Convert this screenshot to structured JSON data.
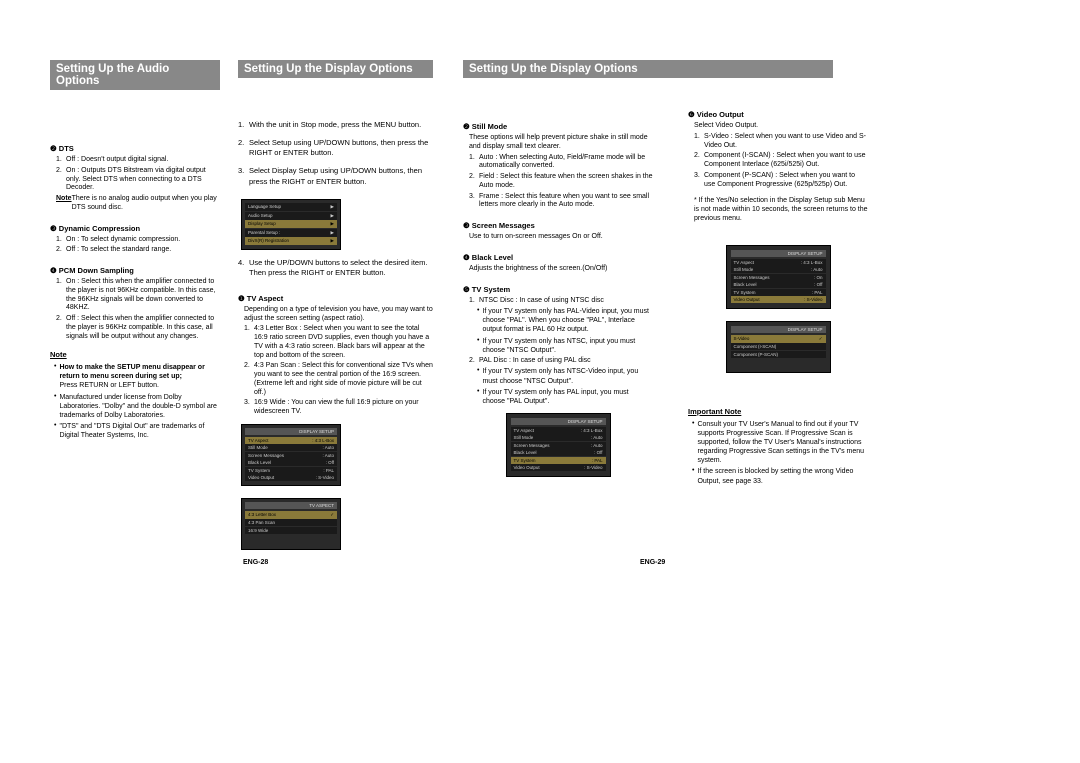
{
  "headers": {
    "h1": "Setting Up the Audio Options",
    "h2": "Setting Up the Display Options",
    "h3": "Setting Up the Display Options"
  },
  "col1": {
    "s1_hd": "❷ DTS",
    "s1_i1n": "1.",
    "s1_i1t": "Off : Doesn't output digital signal.",
    "s1_i2n": "2.",
    "s1_i2t": "On : Outputs DTS Bitstream via digital output only. Select DTS when connecting to a DTS Decoder.",
    "s1_note_pre": "Note",
    "s1_note": "There is no analog audio output when you play DTS sound disc.",
    "s2_hd": "❸ Dynamic Compression",
    "s2_i1n": "1.",
    "s2_i1t": "On : To select dynamic compression.",
    "s2_i2n": "2.",
    "s2_i2t": "Off : To select the standard range.",
    "s3_hd": "❹ PCM Down Sampling",
    "s3_i1n": "1.",
    "s3_i1t": "On : Select this when the amplifier connected to the player is not 96KHz compatible. In this case, the 96KHz signals will be down converted to 48KHZ.",
    "s3_i2n": "2.",
    "s3_i2t": "Off : Select this when the amplifier connected to the player is 96KHz compatible. In this case, all signals will be output without any changes.",
    "note_hd": "Note",
    "b1": "How to make the SETUP menu disappear or return to menu screen during set up;",
    "b1b": "Press RETURN or LEFT button.",
    "b2": "Manufactured under license from Dolby Laboratories. \"Dolby\" and the double-D symbol are trademarks of Dolby Laboratories.",
    "b3": "\"DTS\" and \"DTS Digital Out\" are trademarks of Digital Theater Systems, Inc."
  },
  "col2": {
    "st1n": "1.",
    "st1t": "With the unit in Stop mode, press the MENU button.",
    "st2n": "2.",
    "st2t": "Select Setup using UP/DOWN buttons, then press the RIGHT or ENTER button.",
    "st3n": "3.",
    "st3t": "Select Display Setup using UP/DOWN buttons, then press the RIGHT or ENTER button.",
    "ss1_title": "",
    "ss1_r1": "Language Setup",
    "ss1_r1r": "▶",
    "ss1_r2": "Audio Setup",
    "ss1_r2r": "▶",
    "ss1_r3": "Display Setup",
    "ss1_r3r": "▶",
    "ss1_r4": "Parental Setup :",
    "ss1_r4r": "▶",
    "ss1_r5": "DivX(R) Registration",
    "ss1_r5r": "▶",
    "st4n": "4.",
    "st4t": "Use the UP/DOWN buttons to select the desired item. Then press the RIGHT or ENTER button.",
    "s1_hd": "❶ TV Aspect",
    "s1_desc": "Depending on a type of television you have, you may want to adjust the screen setting (aspect ratio).",
    "s1_i1n": "1.",
    "s1_i1t": "4:3 Letter Box : Select when you want to see the total 16:9 ratio screen DVD supplies, even though you have a TV with a 4:3 ratio screen. Black bars will appear at the top and bottom of the screen.",
    "s1_i2n": "2.",
    "s1_i2t": "4:3 Pan Scan : Select this for conventional size TVs when you want to see the central portion of the 16:9 screen. (Extreme left and right side of movie picture will be cut off.)",
    "s1_i3n": "3.",
    "s1_i3t": "16:9 Wide : You can view the full 16:9 picture on your widescreen TV.",
    "ss2_title": "DISPLAY SETUP",
    "ss2_r1l": "TV Aspect",
    "ss2_r1r": ": 4:3 L-Box",
    "ss2_r2l": "Still Mode",
    "ss2_r2r": ": Auto",
    "ss2_r3l": "Screen Messages",
    "ss2_r3r": ": Auto",
    "ss2_r4l": "Black Level",
    "ss2_r4r": ": Off",
    "ss2_r5l": "TV System",
    "ss2_r5r": ": PAL",
    "ss2_r6l": "Video Output",
    "ss2_r6r": ": S-Video",
    "ss3_title": "TV ASPECT",
    "ss3_r1": "4:3 Letter Box",
    "ss3_r1r": "✓",
    "ss3_r2": "4:3 Pan Scan",
    "ss3_r3": "16:9 Wide"
  },
  "col3": {
    "s1_hd": "❷ Still Mode",
    "s1_desc": "These options will help prevent picture shake in still mode and display small text clearer.",
    "s1_i1n": "1.",
    "s1_i1t": "Auto : When selecting Auto, Field/Frame mode will be automatically converted.",
    "s1_i2n": "2.",
    "s1_i2t": "Field : Select this feature when the screen shakes in the Auto mode.",
    "s1_i3n": "3.",
    "s1_i3t": "Frame : Select this feature when you want to see small letters more clearly in the Auto mode.",
    "s2_hd": "❸ Screen Messages",
    "s2_desc": "Use to turn on-screen messages On or Off.",
    "s3_hd": "❹ Black Level",
    "s3_desc": "Adjusts the brightness of the screen.(On/Off)",
    "s4_hd": "❺ TV System",
    "s4_i1n": "1.",
    "s4_i1t": "NTSC Disc : In case of using NTSC disc",
    "s4_b1": "If your TV system only has PAL-Video input, you must choose \"PAL\". When you choose \"PAL\", Interlace output format is PAL 60 Hz output.",
    "s4_b2": "If your TV system only has NTSC, input you must choose \"NTSC Output\".",
    "s4_i2n": "2.",
    "s4_i2t": "PAL Disc : In case of using PAL disc",
    "s4_b3": "If your TV system only has NTSC-Video input, you must choose \"NTSC Output\".",
    "s4_b4": "If your TV system only has PAL input, you must choose \"PAL Output\".",
    "ss_title": "DISPLAY SETUP",
    "ss_r1l": "TV Aspect",
    "ss_r1r": ": 4:3 L-Box",
    "ss_r2l": "Still Mode",
    "ss_r2r": ": Auto",
    "ss_r3l": "Screen Messages",
    "ss_r3r": ": Auto",
    "ss_r4l": "Black Level",
    "ss_r4r": ": Off",
    "ss_r5l": "TV System",
    "ss_r5r": ": PAL",
    "ss_r6l": "Video Output",
    "ss_r6r": ": S-Video"
  },
  "col4": {
    "s1_hd": "❻ Video Output",
    "s1_desc": "Select Video Output.",
    "s1_i1n": "1.",
    "s1_i1t": "S-Video : Select when you want to use Video and S-Video Out.",
    "s1_i2n": "2.",
    "s1_i2t": "Component (I-SCAN) : Select when you want to use Component Interlace (625i/525i) Out.",
    "s1_i3n": "3.",
    "s1_i3t": "Component (P-SCAN) : Select when you want to use Component Progressive (625p/525p) Out.",
    "s1_star": "* If the Yes/No selection in the Display Setup sub Menu is not made within 10 seconds, the screen returns to the previous menu.",
    "ss1_title": "DISPLAY SETUP",
    "ss1_r1l": "TV Aspect",
    "ss1_r1r": ": 4:3 L-Box",
    "ss1_r2l": "Still Mode",
    "ss1_r2r": ": Auto",
    "ss1_r3l": "Screen Messages",
    "ss1_r3r": ": On",
    "ss1_r4l": "Black Level",
    "ss1_r4r": ": Off",
    "ss1_r5l": "TV System",
    "ss1_r5r": ": PAL",
    "ss1_r6l": "Video Output",
    "ss1_r6r": ": S-Video",
    "ss2_title": "DISPLAY SETUP",
    "ss2_r1l": "S-Video",
    "ss2_r1r": "✓",
    "ss2_r2l": "Component (I-SCAN)",
    "ss2_r3l": "Component (P-SCAN)",
    "note_hd": "Important Note",
    "b1": "Consult your TV User's Manual to find out if your TV supports Progressive Scan. If Progressive Scan is supported, follow the TV User's Manual's instructions regarding Progressive Scan settings in the TV's menu system.",
    "b2": "If the screen is blocked by setting the wrong Video Output, see page 33."
  },
  "pagenum_l": "ENG-28",
  "pagenum_r": "ENG-29"
}
